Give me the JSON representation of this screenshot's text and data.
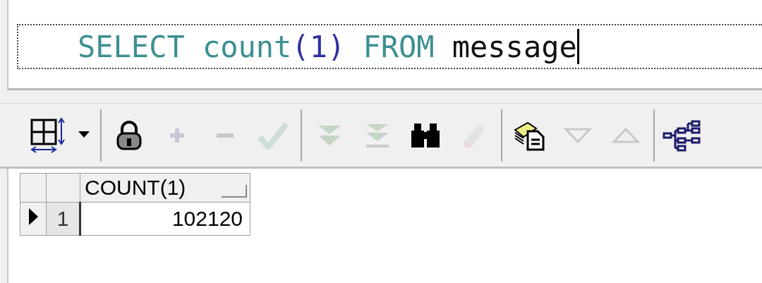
{
  "editor": {
    "tokens": [
      {
        "text": "SELECT",
        "kind": "keyword"
      },
      {
        "text": "count",
        "kind": "keyword"
      },
      {
        "text": "(1)",
        "kind": "number"
      },
      {
        "text": "FROM",
        "kind": "keyword"
      },
      {
        "text": "message",
        "kind": "plain"
      }
    ]
  },
  "toolbar": {
    "groups": [
      [
        {
          "kind": "grid-menu",
          "disabled": false
        }
      ],
      [
        {
          "kind": "lock",
          "disabled": false
        },
        {
          "kind": "plus",
          "disabled": true
        },
        {
          "kind": "minus",
          "disabled": true
        },
        {
          "kind": "check",
          "disabled": true
        }
      ],
      [
        {
          "kind": "fetch-next",
          "disabled": true
        },
        {
          "kind": "fetch-last",
          "disabled": true
        },
        {
          "kind": "find",
          "disabled": false
        },
        {
          "kind": "clear",
          "disabled": true
        }
      ],
      [
        {
          "kind": "export",
          "disabled": false
        },
        {
          "kind": "down",
          "disabled": true
        },
        {
          "kind": "up",
          "disabled": true
        }
      ],
      [
        {
          "kind": "tree",
          "disabled": false
        }
      ]
    ]
  },
  "table": {
    "columns": [
      "COUNT(1)"
    ],
    "rows": [
      {
        "number": "1",
        "selected": true,
        "cells": [
          "102120"
        ]
      }
    ]
  }
}
